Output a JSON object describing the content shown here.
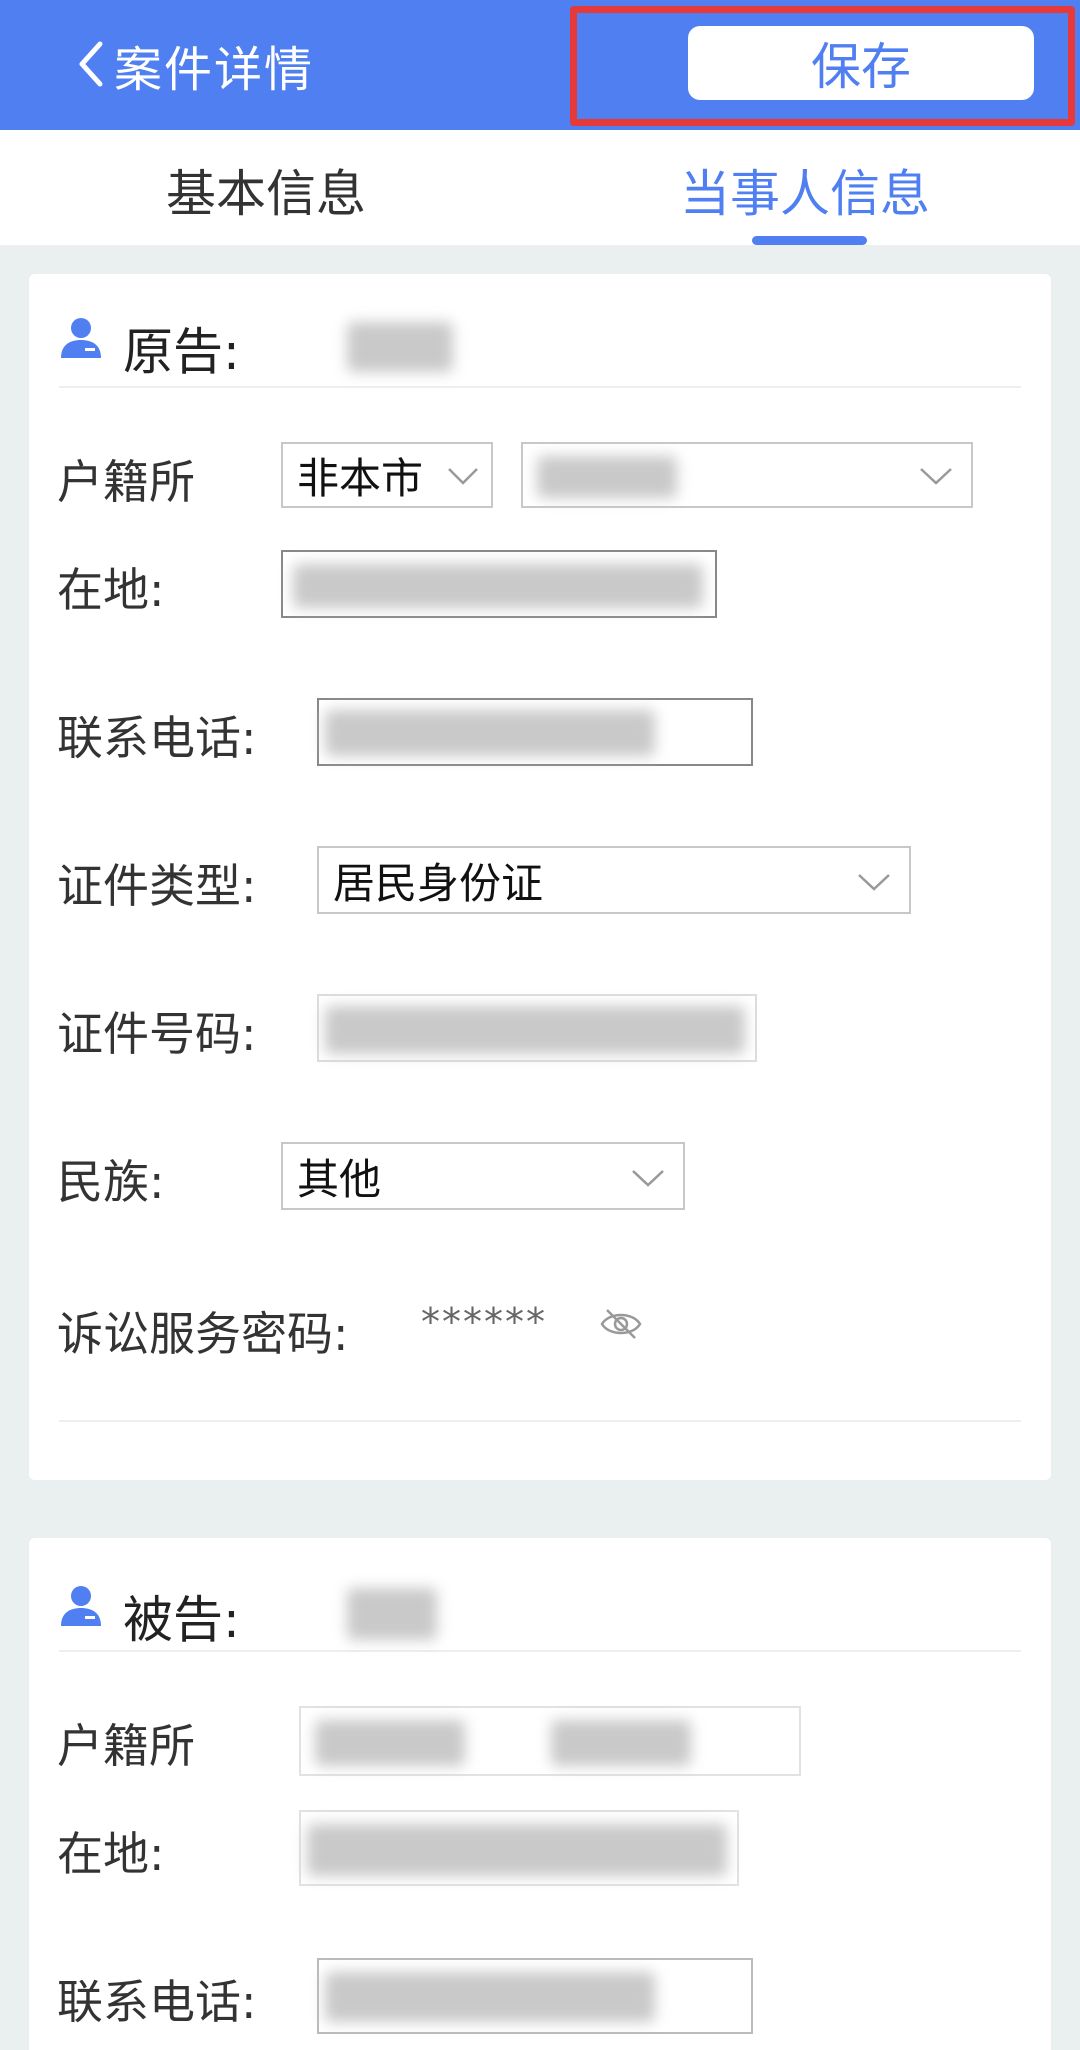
{
  "header": {
    "title": "案件详情",
    "save_label": "保存"
  },
  "tabs": [
    {
      "label": "基本信息",
      "active": false
    },
    {
      "label": "当事人信息",
      "active": true
    }
  ],
  "plaintiff": {
    "role": "原告:",
    "residence_label_1": "户籍所",
    "residence_label_2": "在地:",
    "residence_select": "非本市",
    "phone_label": "联系电话:",
    "id_type_label": "证件类型:",
    "id_type_value": "居民身份证",
    "id_number_label": "证件号码:",
    "ethnicity_label": "民族:",
    "ethnicity_value": "其他",
    "password_label": "诉讼服务密码:",
    "password_value": "******"
  },
  "defendant": {
    "role": "被告:",
    "residence_label_1": "户籍所",
    "residence_label_2": "在地:",
    "phone_label": "联系电话:"
  },
  "colors": {
    "accent": "#4f7ff0",
    "highlight_border": "#e63939",
    "background": "#eaf0f0"
  }
}
